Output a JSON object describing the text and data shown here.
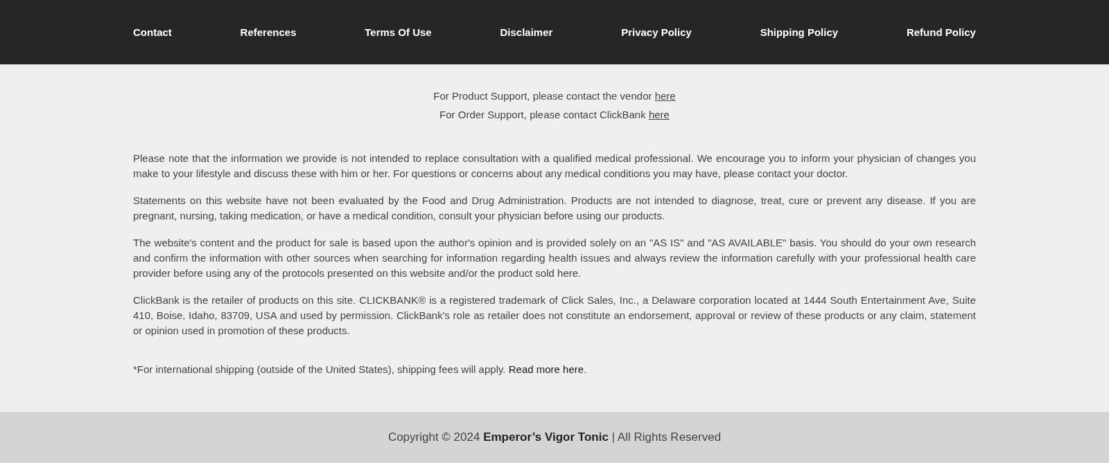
{
  "nav": {
    "links": [
      "Contact",
      "References",
      "Terms Of Use",
      "Disclaimer",
      "Privacy Policy",
      "Shipping Policy",
      "Refund Policy"
    ]
  },
  "support": [
    {
      "text": "For Product Support, please contact the vendor",
      "link": "here"
    },
    {
      "text": "For Order Support, please contact ClickBank",
      "link": "here"
    }
  ],
  "disclaimers": [
    "Please note that the information we provide is not intended to replace consultation with a qualified medical professional. We encourage you to inform your physician of changes you make to your lifestyle and discuss these with him or her. For questions or concerns about any medical conditions you may have, please contact your doctor.",
    "Statements on this website have not been evaluated by the Food and Drug Administration. Products are not intended to diagnose, treat, cure or prevent any disease. If you are pregnant, nursing, taking medication, or have a medical condition, consult your physician before using our products.",
    "The website's content and the product for sale is based upon the author's opinion and is provided solely on an \"AS IS\" and \"AS AVAILABLE\" basis. You should do your own research and confirm the information with other sources when searching for information regarding health issues and always review the information carefully with your professional health care provider before using any of the protocols presented on this website and/or the product sold here.",
    "ClickBank is the retailer of products on this site. CLICKBANK® is a registered trademark of Click Sales, Inc., a Delaware corporation located at 1444 South Entertainment Ave, Suite 410, Boise, Idaho, 83709, USA and used by permission. ClickBank's role as retailer does not constitute an endorsement, approval or review of these products or any claim, statement or opinion used in promotion of these products."
  ],
  "shipping_note": {
    "text": "*For international shipping (outside of the United States), shipping fees will apply.",
    "link": "Read more here",
    "after": "."
  },
  "footer": {
    "copyright": "Copyright © 2024 **Emperor’s Vigor Tonic** | All Rights Reserved"
  }
}
